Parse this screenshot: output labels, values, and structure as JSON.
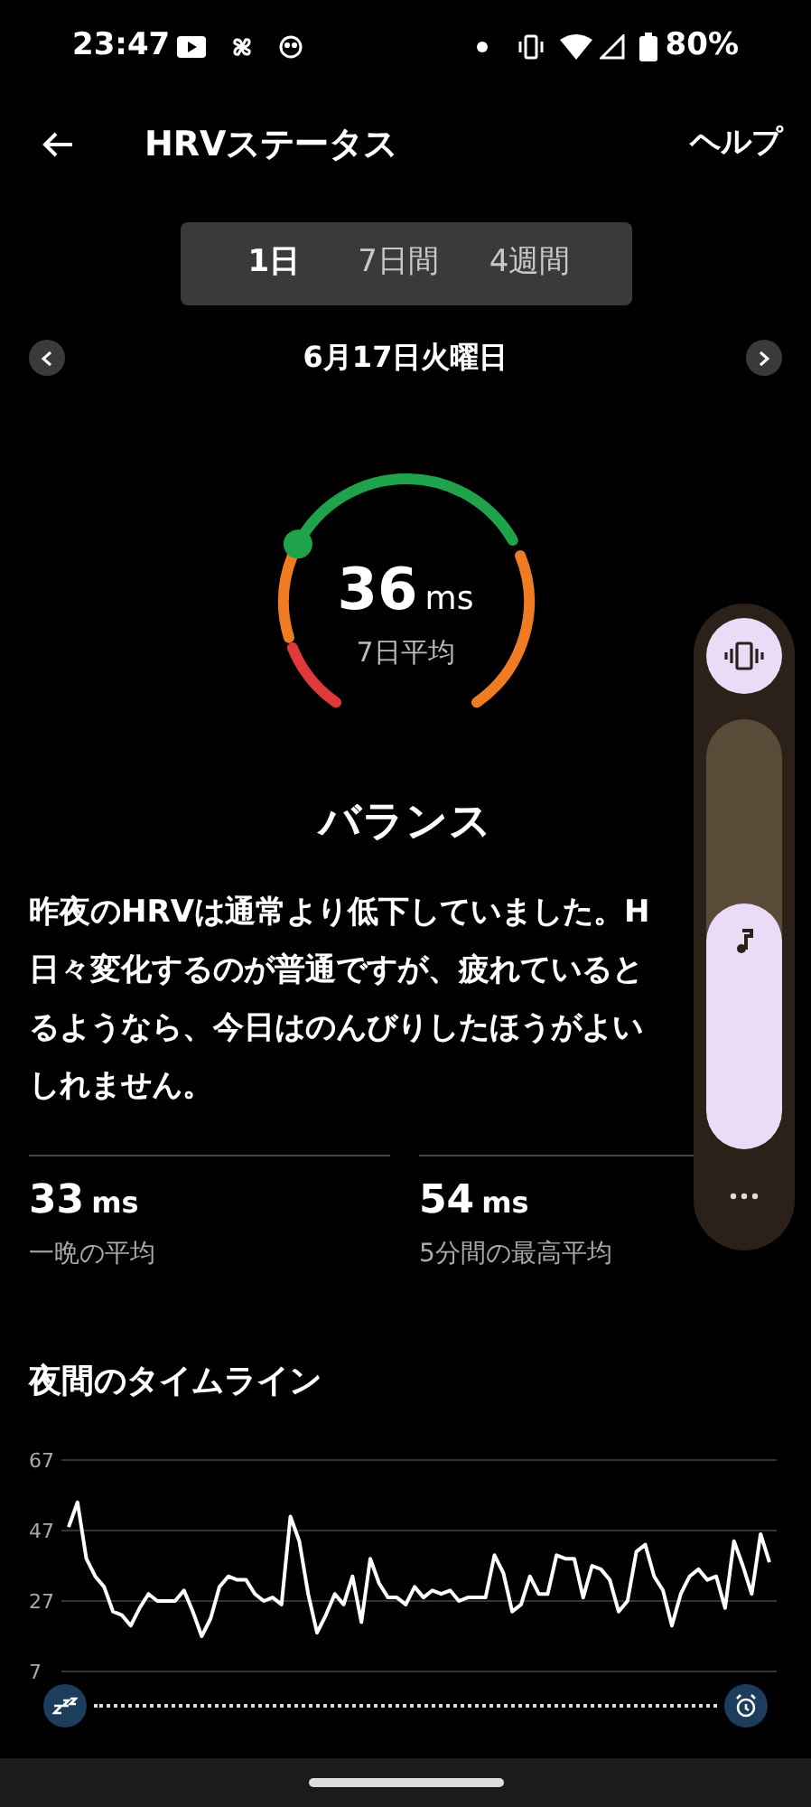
{
  "status_bar": {
    "time": "23:47",
    "battery": "80%"
  },
  "header": {
    "title": "HRVステータス",
    "help": "ヘルプ"
  },
  "tabs": [
    {
      "label": "1日",
      "selected": true
    },
    {
      "label": "7日間",
      "selected": false
    },
    {
      "label": "4週間",
      "selected": false
    }
  ],
  "date": "6月17日火曜日",
  "gauge": {
    "value": "36",
    "unit": "ms",
    "caption": "7日平均"
  },
  "status": "バランス",
  "description_lines": [
    "昨夜のHRVは通常より低下していました。H",
    "日々変化するのが普通ですが、疲れていると",
    "るようなら、今日はのんびりしたほうがよい",
    "しれません。"
  ],
  "stats": [
    {
      "value": "33",
      "unit": "ms",
      "label": "一晩の平均"
    },
    {
      "value": "54",
      "unit": "ms",
      "label": "5分間の最高平均"
    }
  ],
  "timeline": {
    "title": "夜間のタイムライン",
    "chart_data": {
      "type": "line",
      "ylim": [
        7,
        67
      ],
      "yticks": [
        7,
        27,
        47,
        67
      ],
      "series": [
        {
          "color": "#ffffff",
          "values": [
            48,
            55,
            39,
            34,
            31,
            24,
            23,
            20,
            25,
            29,
            27,
            27,
            27,
            30,
            24,
            17,
            22,
            31,
            34,
            33,
            33,
            29,
            27,
            28,
            26,
            51,
            44,
            29,
            18,
            23,
            29,
            26,
            34,
            21,
            39,
            32,
            28,
            28,
            26,
            31,
            28,
            30,
            29,
            30,
            27,
            28,
            28,
            28,
            40,
            35,
            24,
            26,
            34,
            29,
            29,
            40,
            39,
            39,
            28,
            37,
            36,
            33,
            24,
            27,
            41,
            43,
            34,
            30,
            20,
            29,
            34,
            36,
            33,
            34,
            25,
            44,
            37,
            29,
            46,
            38
          ]
        }
      ]
    }
  },
  "volume_panel": {
    "level": 0.57
  }
}
